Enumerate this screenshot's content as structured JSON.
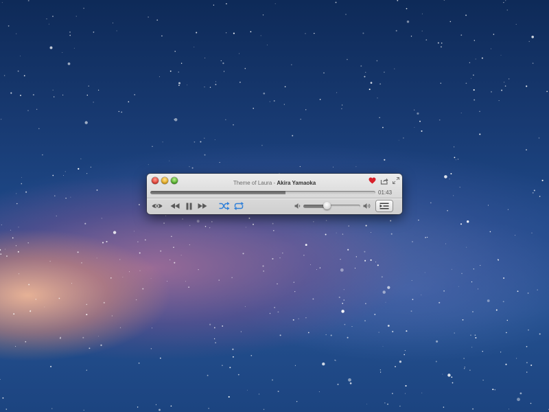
{
  "window": {
    "controls": {
      "close": "close",
      "minimize": "minimize",
      "zoom": "zoom"
    }
  },
  "now_playing": {
    "song": "Theme of Laura",
    "separator": " - ",
    "artist": "Akira Yamaoka",
    "elapsed": "01:43",
    "progress_fraction": 0.6
  },
  "title_bar_icons": {
    "favorite": "heart-icon",
    "share": "share-icon",
    "expand": "expand-icon"
  },
  "transport": {
    "show": "eye-icon",
    "rewind": "rewind-icon",
    "pause": "pause-icon",
    "forward": "fast-forward-icon",
    "shuffle": "shuffle-icon",
    "repeat": "repeat-icon",
    "playlist": "playlist-icon"
  },
  "volume": {
    "level_fraction": 0.42,
    "low_icon": "volume-low-icon",
    "high_icon": "volume-high-icon"
  },
  "colors": {
    "heart": "#d8202a",
    "shuffle_repeat_active": "#2e7fd9",
    "control_gray": "#5a5a5a"
  }
}
